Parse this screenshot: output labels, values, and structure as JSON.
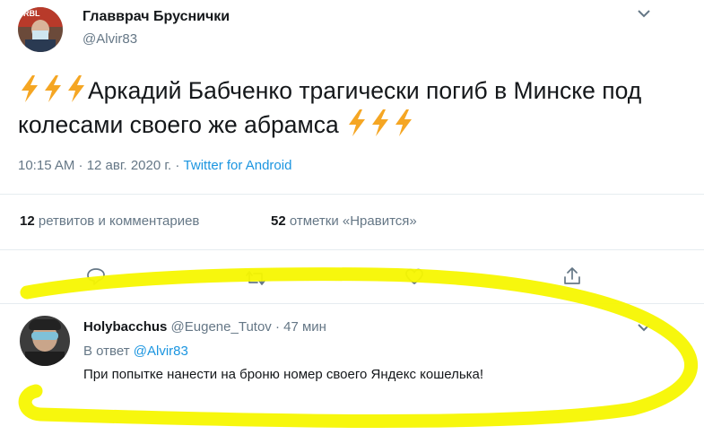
{
  "tweet": {
    "author_name": "Главврач Бруснички",
    "author_handle": "@Alvir83",
    "text": "Аркадий Бабченко трагически погиб в Минске под колесами своего же абрамса",
    "time": "10:15 AM · 12 авг. 2020 г. · ",
    "source": "Twitter for Android",
    "retweets_count": "12",
    "retweets_label": "ретвитов и комментариев",
    "likes_count": "52",
    "likes_label": "отметки «Нравится»",
    "avatar_text": "RBL"
  },
  "reply": {
    "author_name": "Holybacchus",
    "author_handle": "@Eugene_Tutov",
    "time": " · 47 мин",
    "reply_to_prefix": "В ответ ",
    "reply_to_handle": "@Alvir83",
    "text": "При попытке нанести на броню номер своего Яндекс кошелька!"
  },
  "icons": [
    "chevron-down-icon",
    "lightning-emoji-icon",
    "reply-icon",
    "retweet-icon",
    "like-icon",
    "share-icon"
  ],
  "colors": {
    "link": "#1b95e0",
    "muted": "#657786",
    "highlight": "#f7f700",
    "bolt": "#f5a623"
  }
}
